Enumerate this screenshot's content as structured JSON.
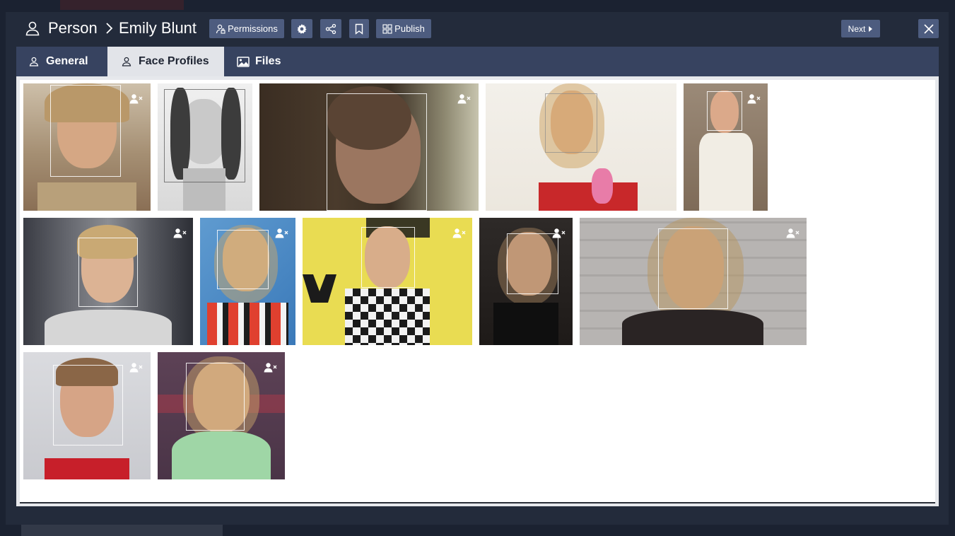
{
  "header": {
    "breadcrumb_root": "Person",
    "breadcrumb_current": "Emily Blunt",
    "permissions_label": "Permissions",
    "publish_label": "Publish",
    "next_label": "Next"
  },
  "tabs": [
    {
      "label": "General",
      "icon": "person-icon",
      "active": false
    },
    {
      "label": "Face Profiles",
      "icon": "person-icon",
      "active": true
    },
    {
      "label": "Files",
      "icon": "image-icon",
      "active": false
    }
  ],
  "colors": {
    "backdrop": "#1b2231",
    "modal": "#232b3b",
    "button": "#4d5c7f",
    "tabbar": "#374360",
    "active_tab": "#e2e4e9"
  },
  "face_profiles": [
    {
      "name": "face-profile-1",
      "icon": "remove-person-icon"
    },
    {
      "name": "face-profile-2",
      "icon": "remove-person-icon"
    },
    {
      "name": "face-profile-3",
      "icon": "remove-person-icon"
    },
    {
      "name": "face-profile-4",
      "icon": "remove-person-icon"
    },
    {
      "name": "face-profile-5",
      "icon": "remove-person-icon"
    },
    {
      "name": "face-profile-6",
      "icon": "remove-person-icon"
    },
    {
      "name": "face-profile-7",
      "icon": "remove-person-icon"
    },
    {
      "name": "face-profile-8",
      "icon": "remove-person-icon"
    },
    {
      "name": "face-profile-9",
      "icon": "remove-person-icon"
    },
    {
      "name": "face-profile-10",
      "icon": "remove-person-icon"
    },
    {
      "name": "face-profile-11",
      "icon": "remove-person-icon"
    },
    {
      "name": "face-profile-12",
      "icon": "remove-person-icon"
    }
  ]
}
